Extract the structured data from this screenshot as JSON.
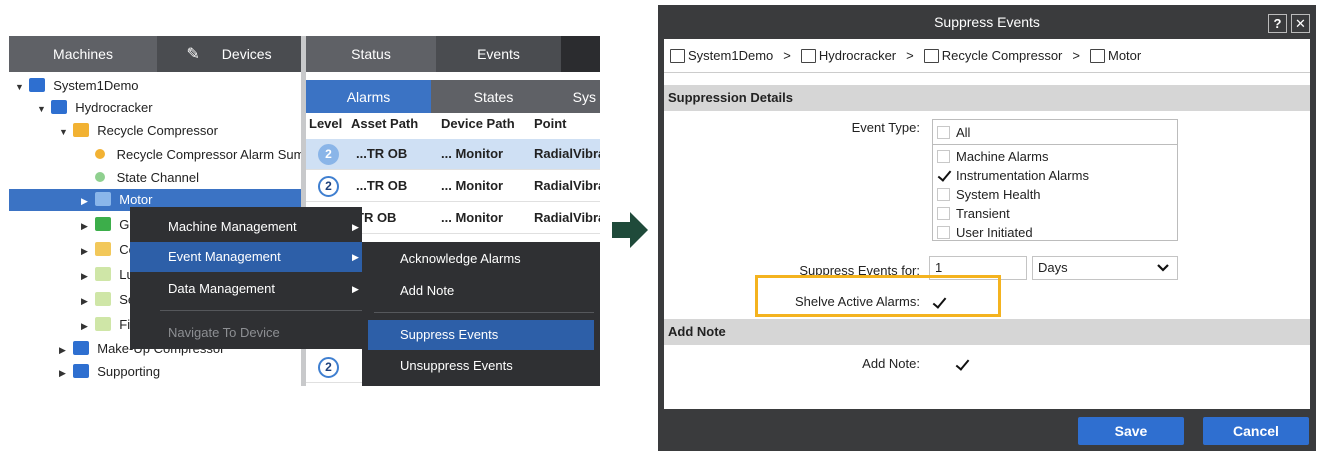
{
  "left_panel": {
    "tabs": [
      {
        "label": "Machines"
      },
      {
        "label": "Devices"
      },
      {
        "label": "Status"
      },
      {
        "label": "Events"
      }
    ],
    "tree": [
      {
        "label": "System1Demo"
      },
      {
        "label": "Hydrocracker"
      },
      {
        "label": "Recycle Compressor"
      },
      {
        "label": "Recycle Compressor Alarm Sum"
      },
      {
        "label": "State Channel"
      },
      {
        "label": "Motor"
      },
      {
        "label": "Ge"
      },
      {
        "label": "Co"
      },
      {
        "label": "Lu"
      },
      {
        "label": "Se"
      },
      {
        "label": "Fir"
      },
      {
        "label": "Make-Up Compressor"
      },
      {
        "label": "Supporting"
      }
    ],
    "subtabs": [
      {
        "label": "Alarms"
      },
      {
        "label": "States"
      },
      {
        "label": "Sys"
      }
    ],
    "columns": [
      "Level",
      "Asset Path",
      "Device Path",
      "Point"
    ],
    "rows": [
      {
        "level": "2",
        "asset": "...TR OB",
        "device": "... Monitor",
        "point": "RadialVibra"
      },
      {
        "level": "2",
        "asset": "...TR OB",
        "device": "... Monitor",
        "point": "RadialVibra"
      },
      {
        "level": "2",
        "asset": "TR OB",
        "device": "... Monitor",
        "point": "RadialVibra"
      }
    ],
    "partial_rows": [
      {
        "level": "2"
      }
    ],
    "context_menu": {
      "items": [
        {
          "label": "Machine Management"
        },
        {
          "label": "Event Management"
        },
        {
          "label": "Data Management"
        },
        {
          "label": "Navigate To Device"
        }
      ],
      "submenu": [
        {
          "label": "Acknowledge Alarms"
        },
        {
          "label": "Add Note"
        },
        {
          "label": "Suppress Events"
        },
        {
          "label": "Unsuppress Events"
        }
      ]
    }
  },
  "dialog": {
    "title": "Suppress Events",
    "help_label": "?",
    "close_label": "✕",
    "breadcrumb": [
      {
        "label": "System1Demo"
      },
      {
        "label": "Hydrocracker"
      },
      {
        "label": "Recycle Compressor"
      },
      {
        "label": "Motor"
      }
    ],
    "breadcrumb_separator": ">",
    "section_details": "Suppression Details",
    "event_type_label": "Event Type:",
    "event_types": [
      {
        "label": "All",
        "checked": false
      },
      {
        "label": "Machine Alarms",
        "checked": false
      },
      {
        "label": "Instrumentation Alarms",
        "checked": true
      },
      {
        "label": "System Health",
        "checked": false
      },
      {
        "label": "Transient",
        "checked": false
      },
      {
        "label": "User Initiated",
        "checked": false
      }
    ],
    "suppress_for_label": "Suppress Events for:",
    "suppress_for_value": "1",
    "suppress_unit": "Days",
    "shelve_label": "Shelve Active Alarms:",
    "shelve_checked": true,
    "section_note": "Add Note",
    "add_note_label": "Add Note:",
    "add_note_checked": true,
    "save_label": "Save",
    "cancel_label": "Cancel"
  },
  "colors": {
    "selection_blue": "#3b73c4",
    "highlight_orange": "#f4b31f",
    "arrow_green": "#1f4a3a",
    "button_blue": "#2f6fd0"
  }
}
